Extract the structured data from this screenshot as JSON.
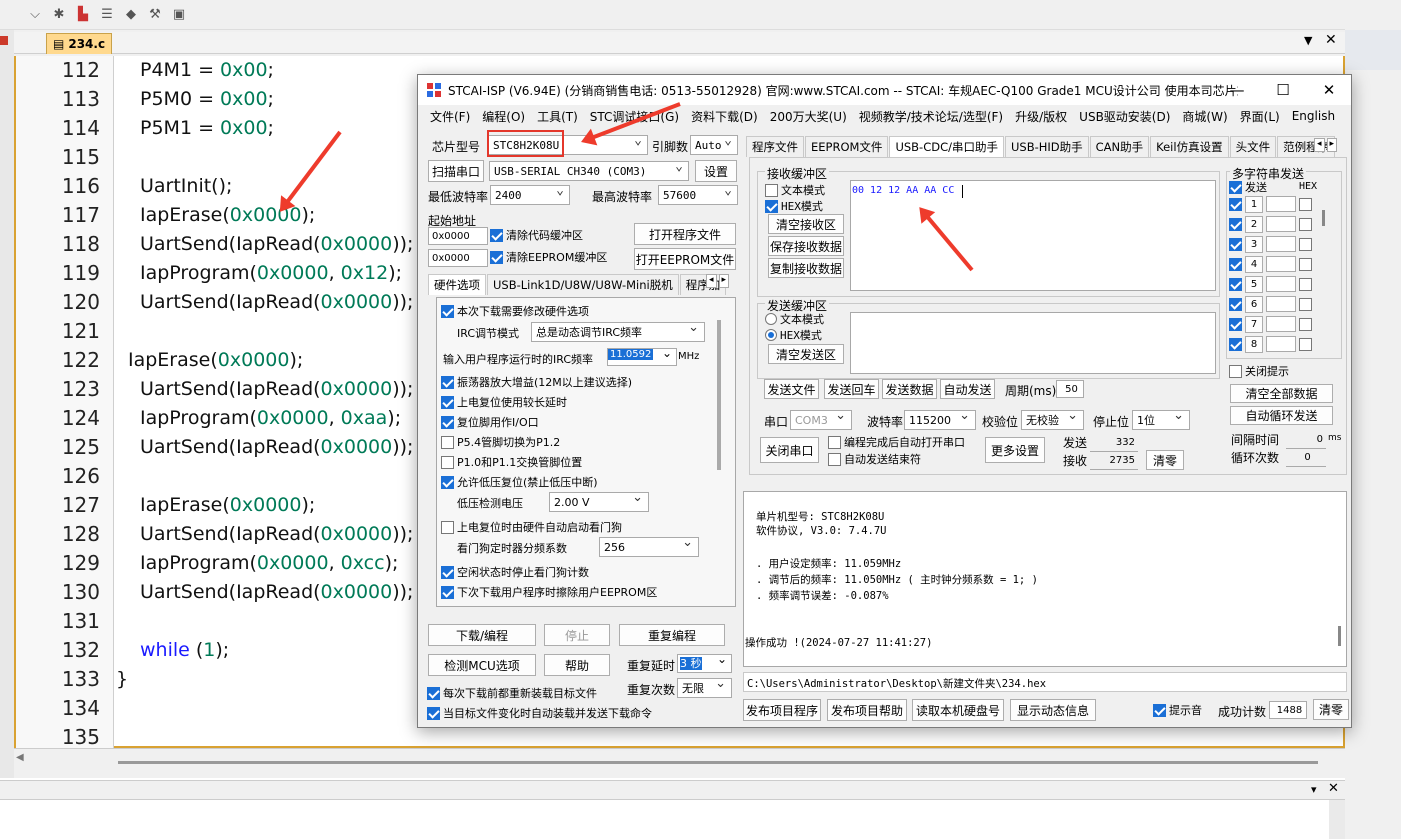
{
  "ide": {
    "file_tab": "234.c",
    "lines": [
      {
        "n": "112",
        "code": [
          [
            "P4M1 = ",
            ""
          ],
          [
            "0x00",
            "num"
          ],
          [
            ";",
            ""
          ]
        ],
        "indent": 0
      },
      {
        "n": "113",
        "code": [
          [
            "P5M0 = ",
            ""
          ],
          [
            "0x00",
            "num"
          ],
          [
            ";",
            ""
          ]
        ],
        "indent": 0
      },
      {
        "n": "114",
        "code": [
          [
            "P5M1 = ",
            ""
          ],
          [
            "0x00",
            "num"
          ],
          [
            ";",
            ""
          ]
        ],
        "indent": 0
      },
      {
        "n": "115",
        "code": [],
        "indent": 0
      },
      {
        "n": "116",
        "code": [
          [
            "UartInit();",
            ""
          ]
        ],
        "indent": 0
      },
      {
        "n": "117",
        "code": [
          [
            "IapErase(",
            ""
          ],
          [
            "0x0000",
            "num"
          ],
          [
            ");",
            ""
          ]
        ],
        "indent": 0
      },
      {
        "n": "118",
        "code": [
          [
            "UartSend(IapRead(",
            ""
          ],
          [
            "0x0000",
            "num"
          ],
          [
            "));",
            ""
          ]
        ],
        "indent": 0
      },
      {
        "n": "119",
        "code": [
          [
            "IapProgram(",
            ""
          ],
          [
            "0x0000",
            "num"
          ],
          [
            ", ",
            ""
          ],
          [
            "0x12",
            "num"
          ],
          [
            ");",
            ""
          ]
        ],
        "indent": 0
      },
      {
        "n": "120",
        "code": [
          [
            "UartSend(IapRead(",
            ""
          ],
          [
            "0x0000",
            "num"
          ],
          [
            "));",
            ""
          ]
        ],
        "indent": 0
      },
      {
        "n": "121",
        "code": [],
        "indent": 0
      },
      {
        "n": "122",
        "code": [
          [
            "IapErase(",
            ""
          ],
          [
            "0x0000",
            "num"
          ],
          [
            ");",
            ""
          ]
        ],
        "indent": -1
      },
      {
        "n": "123",
        "code": [
          [
            "UartSend(IapRead(",
            ""
          ],
          [
            "0x0000",
            "num"
          ],
          [
            "));",
            ""
          ]
        ],
        "indent": 0
      },
      {
        "n": "124",
        "code": [
          [
            "IapProgram(",
            ""
          ],
          [
            "0x0000",
            "num"
          ],
          [
            ", ",
            ""
          ],
          [
            "0xaa",
            "num"
          ],
          [
            ");",
            ""
          ]
        ],
        "indent": 0
      },
      {
        "n": "125",
        "code": [
          [
            "UartSend(IapRead(",
            ""
          ],
          [
            "0x0000",
            "num"
          ],
          [
            "));",
            ""
          ]
        ],
        "indent": 0
      },
      {
        "n": "126",
        "code": [],
        "indent": 0
      },
      {
        "n": "127",
        "code": [
          [
            "IapErase(",
            ""
          ],
          [
            "0x0000",
            "num"
          ],
          [
            ");",
            ""
          ]
        ],
        "indent": 0
      },
      {
        "n": "128",
        "code": [
          [
            "UartSend(IapRead(",
            ""
          ],
          [
            "0x0000",
            "num"
          ],
          [
            "));",
            ""
          ]
        ],
        "indent": 0
      },
      {
        "n": "129",
        "code": [
          [
            "IapProgram(",
            ""
          ],
          [
            "0x0000",
            "num"
          ],
          [
            ", ",
            ""
          ],
          [
            "0xcc",
            "num"
          ],
          [
            ");",
            ""
          ]
        ],
        "indent": 0
      },
      {
        "n": "130",
        "code": [
          [
            "UartSend(IapRead(",
            ""
          ],
          [
            "0x0000",
            "num"
          ],
          [
            "));",
            ""
          ]
        ],
        "indent": 0
      },
      {
        "n": "131",
        "code": [],
        "indent": 0
      },
      {
        "n": "132",
        "code": [
          [
            "while",
            "kw"
          ],
          [
            " (",
            ""
          ],
          [
            "1",
            "num"
          ],
          [
            ");",
            ""
          ]
        ],
        "indent": 0
      },
      {
        "n": "133",
        "code": [
          [
            "}",
            ""
          ]
        ],
        "indent": -2
      },
      {
        "n": "134",
        "code": [],
        "indent": 0
      },
      {
        "n": "135",
        "code": [],
        "indent": 0
      }
    ]
  },
  "stc": {
    "title": "STCAI-ISP (V6.94E) (分销商销售电话: 0513-55012928) 官网:www.STCAI.com  -- STCAI: 车规AEC-Q100 Grade1 MCU设计公司 使用本司芯片或采...",
    "menu": [
      "文件(F)",
      "编程(O)",
      "工具(T)",
      "STC调试接口(G)",
      "资料下载(D)",
      "200万大奖(U)",
      "视频教学/技术论坛/选型(F)",
      "升级/版权",
      "USB驱动安装(D)",
      "商城(W)",
      "界面(L)",
      "English"
    ],
    "chip_label": "芯片型号",
    "chip_value": "STC8H2K08U",
    "pins_label": "引脚数",
    "pins_value": "Auto",
    "scan_btn": "扫描串口",
    "port_value": "USB-SERIAL CH340 (COM3)",
    "settings_btn": "设置",
    "min_baud_label": "最低波特率",
    "min_baud": "2400",
    "max_baud_label": "最高波特率",
    "max_baud": "57600",
    "start_addr_label": "起始地址",
    "addr1": "0x0000",
    "clear_code_buf": "清除代码缓冲区",
    "open_prog_file": "打开程序文件",
    "addr2": "0x0000",
    "clear_eeprom_buf": "清除EEPROM缓冲区",
    "open_eeprom_file": "打开EEPROM文件",
    "hw_tabs": [
      "硬件选项",
      "USB-Link1D/U8W/U8W-Mini脱机",
      "程序加"
    ],
    "hw_options": {
      "opt_modify": "本次下载需要修改硬件选项",
      "irc_mode_label": "IRC调节模式",
      "irc_mode_value": "总是动态调节IRC频率",
      "freq_label": "输入用户程序运行时的IRC频率",
      "freq_value": "11.0592",
      "freq_unit": "MHz",
      "opt_osc": "振荡器放大增益(12M以上建议选择)",
      "opt_reset_delay": "上电复位使用较长延时",
      "opt_reset_io": "复位脚用作I/O口",
      "opt_p54": "P5.4管脚切换为P1.2",
      "opt_p10": "P1.0和P1.1交换管脚位置",
      "opt_lvr": "允许低压复位(禁止低压中断)",
      "lvd_label": "低压检测电压",
      "lvd_value": "2.00 V",
      "opt_wdt": "上电复位时由硬件自动启动看门狗",
      "wdt_div_label": "看门狗定时器分频系数",
      "wdt_div_value": "256",
      "opt_idle": "空闲状态时停止看门狗计数",
      "opt_erase_eeprom": "下次下载用户程序时擦除用户EEPROM区"
    },
    "download_btn": "下载/编程",
    "stop_btn": "停止",
    "reprogram_btn": "重复编程",
    "detect_btn": "检测MCU选项",
    "help_btn": "帮助",
    "repeat_delay_label": "重复延时",
    "repeat_delay_value": "3 秒",
    "repeat_count_label": "重复次数",
    "repeat_count_value": "无限",
    "reload_each": "每次下载前都重新装载目标文件",
    "auto_reload": "当目标文件变化时自动装载并发送下载命令",
    "right_tabs": [
      "程序文件",
      "EEPROM文件",
      "USB-CDC/串口助手",
      "USB-HID助手",
      "CAN助手",
      "Keil仿真设置",
      "头文件",
      "范例程序"
    ],
    "rx_group": "接收缓冲区",
    "rx_text_mode": "文本模式",
    "rx_hex_mode": "HEX模式",
    "rx_clear": "清空接收区",
    "rx_save": "保存接收数据",
    "rx_copy": "复制接收数据",
    "rx_data": "00 12 12 AA AA CC",
    "tx_group": "发送缓冲区",
    "tx_text_mode": "文本模式",
    "tx_hex_mode": "HEX模式",
    "tx_clear": "清空发送区",
    "send_file": "发送文件",
    "send_return": "发送回车",
    "send_data": "发送数据",
    "auto_send": "自动发送",
    "period_label": "周期(ms)",
    "period_value": "50",
    "port_label": "串口",
    "port_short": "COM3",
    "baud_label": "波特率",
    "baud_value": "115200",
    "parity_label": "校验位",
    "parity_value": "无校验",
    "stop_label": "停止位",
    "stop_value": "1位",
    "close_port": "关闭串口",
    "auto_open": "编程完成后自动打开串口",
    "auto_end": "自动发送结束符",
    "more_settings": "更多设置",
    "sent_label": "发送",
    "sent_value": "332",
    "recv_label": "接收",
    "recv_value": "2735",
    "clear_counts": "清零",
    "multi_group": "多字符串发送",
    "multi_send": "发送",
    "multi_hex": "HEX",
    "multi_items": [
      "1",
      "2",
      "3",
      "4",
      "5",
      "6",
      "7",
      "8"
    ],
    "close_tip": "关闭提示",
    "clear_all": "清空全部数据",
    "auto_loop": "自动循环发送",
    "interval_label": "间隔时间",
    "interval_value": "0",
    "interval_unit": "ms",
    "loop_label": "循环次数",
    "loop_value": "0",
    "log": {
      "mcu": "单片机型号: STC8H2K08U",
      "proto": "软件协议, V3.0: 7.4.7U",
      "user_freq": ". 用户设定频率: 11.059MHz",
      "adj_freq": ". 调节后的频率: 11.050MHz ( 主时钟分频系数 = 1; )",
      "err": ". 频率调节误差: -0.087%",
      "ok": "操作成功 !(2024-07-27 11:41:27)"
    },
    "file_path": "C:\\Users\\Administrator\\Desktop\\新建文件夹\\234.hex",
    "publish_prog": "发布项目程序",
    "publish_help": "发布项目帮助",
    "read_disk": "读取本机硬盘号",
    "dyn_info": "显示动态信息",
    "beep": "提示音",
    "success_label": "成功计数",
    "success_value": "1488",
    "success_clear": "清零"
  }
}
